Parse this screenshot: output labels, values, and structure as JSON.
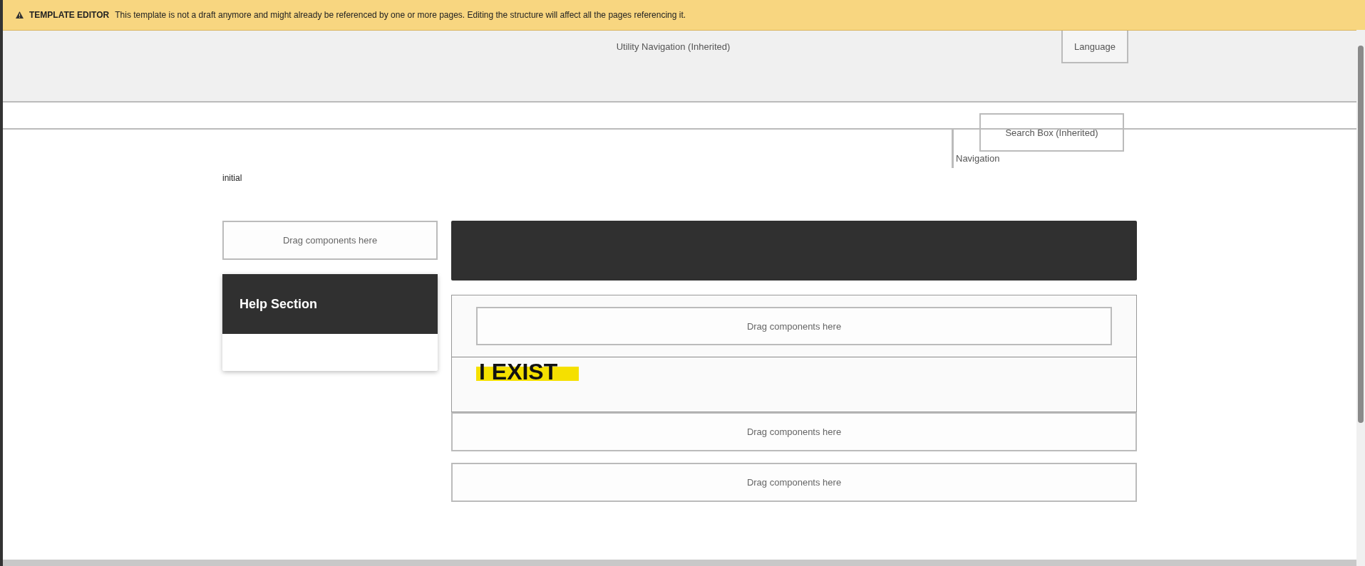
{
  "banner": {
    "title": "TEMPLATE EDITOR",
    "message": "This template is not a draft anymore and might already be referenced by one or more pages. Editing the structure will affect all the pages referencing it."
  },
  "header": {
    "utility_navigation": "Utility Navigation (Inherited)",
    "language": "Language",
    "navigation": "Navigation",
    "search_box": "Search Box (Inherited)"
  },
  "label": "initial",
  "left_column": {
    "placeholder": "Drag components here",
    "help_section": {
      "title": "Help Section"
    }
  },
  "right_column": {
    "inner_placeholder": "Drag components here",
    "highlight_text": "I EXIST",
    "placeholders": [
      "Drag components here",
      "Drag components here"
    ]
  }
}
